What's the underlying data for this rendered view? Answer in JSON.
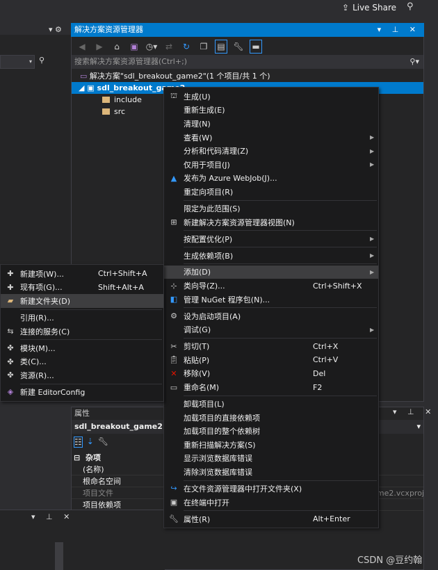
{
  "topbar": {
    "live_share": "Live Share",
    "live_share_icon": "share-icon",
    "feedback_icon": "feedback-icon"
  },
  "solution_explorer": {
    "title": "解决方案资源管理器",
    "search_placeholder": "搜索解决方案资源管理器(Ctrl+;)",
    "solution": "解决方案\"sdl_breakout_game2\"(1 个项目/共 1 个)",
    "project": "sdl_breakout_game2",
    "folders": [
      "include",
      "src"
    ]
  },
  "properties": {
    "title": "属性",
    "object": "sdl_breakout_game2 项目属性",
    "category": "杂项",
    "rows": [
      "(名称)",
      "根命名空间",
      "项目文件",
      "项目依赖项"
    ],
    "project_file_value": "sdl_breakout_game2.vcxproj"
  },
  "context_menu": [
    {
      "label": "生成(U)",
      "icon": "build-icon"
    },
    {
      "label": "重新生成(E)"
    },
    {
      "label": "清理(N)"
    },
    {
      "label": "查看(W)",
      "submenu": true
    },
    {
      "label": "分析和代码清理(Z)",
      "submenu": true
    },
    {
      "label": "仅用于项目(J)",
      "submenu": true
    },
    {
      "label": "发布为 Azure WebJob(J)...",
      "icon": "azure-icon"
    },
    {
      "label": "重定向项目(R)"
    },
    {
      "separator": true
    },
    {
      "label": "限定为此范围(S)"
    },
    {
      "label": "新建解决方案资源管理器视图(N)",
      "icon": "new-view-icon"
    },
    {
      "separator": true
    },
    {
      "label": "按配置优化(P)",
      "submenu": true
    },
    {
      "separator": true
    },
    {
      "label": "生成依赖项(B)",
      "submenu": true
    },
    {
      "separator": true
    },
    {
      "label": "添加(D)",
      "submenu": true,
      "highlighted": true
    },
    {
      "label": "类向导(Z)...",
      "icon": "class-wizard-icon",
      "shortcut": "Ctrl+Shift+X"
    },
    {
      "label": "管理 NuGet 程序包(N)...",
      "icon": "nuget-icon"
    },
    {
      "separator": true
    },
    {
      "label": "设为启动项目(A)",
      "icon": "gear-icon"
    },
    {
      "label": "调试(G)",
      "submenu": true
    },
    {
      "separator": true
    },
    {
      "label": "剪切(T)",
      "icon": "scissors-icon",
      "shortcut": "Ctrl+X"
    },
    {
      "label": "粘贴(P)",
      "icon": "paste-icon",
      "shortcut": "Ctrl+V"
    },
    {
      "label": "移除(V)",
      "icon": "remove-icon",
      "shortcut": "Del"
    },
    {
      "label": "重命名(M)",
      "icon": "rename-icon",
      "shortcut": "F2"
    },
    {
      "separator": true
    },
    {
      "label": "卸载项目(L)"
    },
    {
      "label": "加载项目的直接依赖项"
    },
    {
      "label": "加载项目的整个依赖树"
    },
    {
      "label": "重新扫描解决方案(S)"
    },
    {
      "label": "显示浏览数据库错误"
    },
    {
      "label": "清除浏览数据库错误"
    },
    {
      "separator": true
    },
    {
      "label": "在文件资源管理器中打开文件夹(X)",
      "icon": "open-folder-icon"
    },
    {
      "label": "在终端中打开",
      "icon": "terminal-icon"
    },
    {
      "separator": true
    },
    {
      "label": "属性(R)",
      "icon": "wrench-icon",
      "shortcut": "Alt+Enter"
    }
  ],
  "add_submenu": [
    {
      "label": "新建项(W)...",
      "icon": "new-item-icon",
      "shortcut": "Ctrl+Shift+A"
    },
    {
      "label": "现有项(G)...",
      "icon": "existing-item-icon",
      "shortcut": "Shift+Alt+A"
    },
    {
      "label": "新建文件夹(D)",
      "icon": "new-folder-icon",
      "highlighted": true
    },
    {
      "separator": true
    },
    {
      "label": "引用(R)..."
    },
    {
      "label": "连接的服务(C)",
      "icon": "connected-service-icon"
    },
    {
      "separator": true
    },
    {
      "label": "模块(M)...",
      "icon": "module-icon"
    },
    {
      "label": "类(C)...",
      "icon": "class-icon"
    },
    {
      "label": "资源(R)...",
      "icon": "resource-icon"
    },
    {
      "separator": true
    },
    {
      "label": "新建 EditorConfig",
      "icon": "editorconfig-icon"
    }
  ],
  "watermark": "CSDN @豆约翰",
  "colors": {
    "accent": "#007acc",
    "menu_bg": "#1b1b1c",
    "highlight": "#3e3e40"
  }
}
